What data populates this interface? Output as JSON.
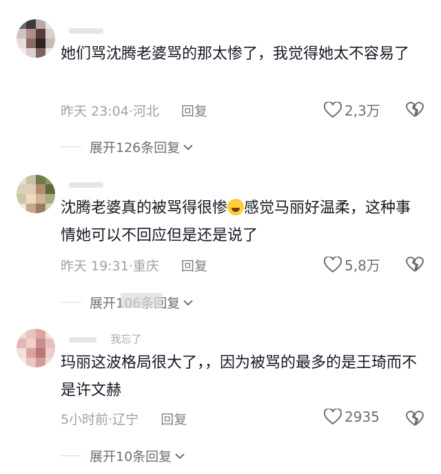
{
  "comments": [
    {
      "username": "",
      "text": "她们骂沈腾老婆骂的那太惨了，我觉得她太不容易了",
      "time": "昨天 23:04",
      "location": "河北",
      "reply_label": "回复",
      "likes": "2,3万",
      "expand_label": "展开126条回复"
    },
    {
      "username": "",
      "text_before": "沈腾老婆真的被骂得很惨",
      "text_after": "感觉马丽好温柔，这种事情她可以不回应但是还是说了",
      "time": "昨天 19:31",
      "location": "重庆",
      "reply_label": "回复",
      "likes": "5,8万",
      "expand_label": "展开106条回复"
    },
    {
      "username": "我忘了",
      "text": "玛丽这波格局很大了，，因为被骂的最多的是王琦而不是许文赫",
      "time": "5小时前",
      "location": "辽宁",
      "reply_label": "回复",
      "likes": "2935",
      "expand_label": "展开10条回复"
    }
  ],
  "colors": {
    "text": "#161823",
    "meta": "#9ea0a6",
    "icon": "#6c6e75"
  },
  "icons": [
    "heart-icon",
    "broken-heart-icon",
    "chevron-down-icon",
    "laughing-emoji"
  ]
}
